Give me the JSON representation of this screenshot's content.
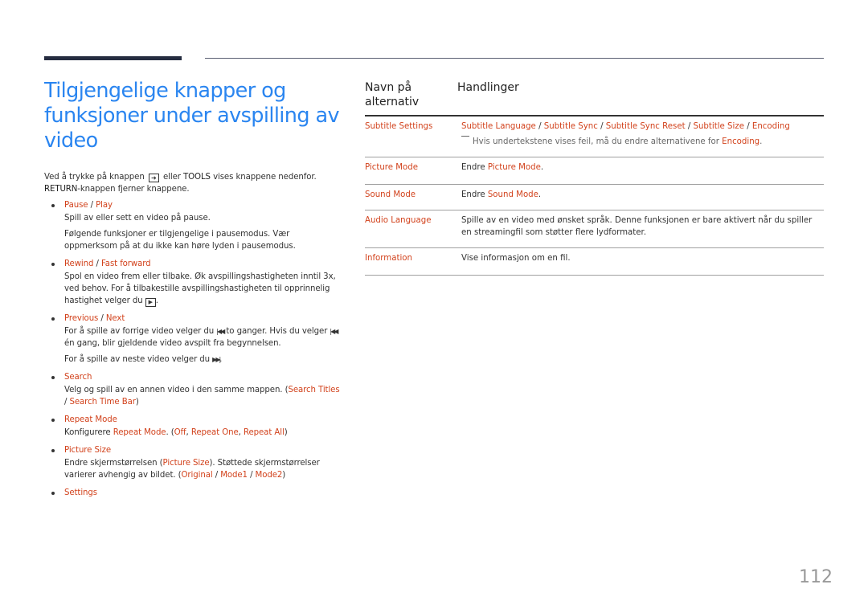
{
  "page": {
    "title": "Tilgjengelige knapper og funksjoner under avspilling av video",
    "page_number": "112"
  },
  "intro": {
    "part1": "Ved å trykke på knappen",
    "icon": "tools-button-icon",
    "part2": "eller",
    "tools": "TOOLS",
    "part3": "vises knappene nedenfor.",
    "return": "RETURN",
    "part4": "-knappen fjerner knappene."
  },
  "items": {
    "pause": {
      "a": "Pause",
      "sep": " / ",
      "b": "Play",
      "desc1": "Spill av eller sett en video på pause.",
      "desc2": "Følgende funksjoner er tilgjengelige i pausemodus. Vær oppmerksom på at du ikke kan høre lyden i pausemodus."
    },
    "rewind": {
      "a": "Rewind",
      "sep": " / ",
      "b": "Fast forward",
      "desc1": "Spol en video frem eller tilbake. Øk avspillingshastigheten inntil 3x, ved behov. For å tilbakestille avspillingshastigheten til opprinnelig hastighet velger du",
      "desc1_end": ".",
      "icon": "play-button-icon"
    },
    "previous": {
      "a": "Previous",
      "sep": " / ",
      "b": "Next",
      "desc1_a": "For å spille av forrige video velger du",
      "desc1_b": "to ganger. Hvis du velger",
      "desc1_c": "én gang, blir gjeldende video avspilt fra begynnelsen.",
      "desc2_a": "For å spille av neste video velger du",
      "desc2_b": ".",
      "prev_icon": "previous-track-icon",
      "next_icon": "next-track-icon"
    },
    "search": {
      "title": "Search",
      "desc_a": "Velg og spill av en annen video i den samme mappen. (",
      "opt1": "Search Titles",
      "sep": " / ",
      "opt2": "Search Time Bar",
      "desc_b": ")"
    },
    "repeat": {
      "title": "Repeat Mode",
      "desc_a": "Konfigurere ",
      "mode": "Repeat Mode",
      "desc_b": ". (",
      "opt1": "Off",
      "comma1": ", ",
      "opt2": "Repeat One",
      "comma2": ", ",
      "opt3": "Repeat All",
      "desc_c": ")"
    },
    "picture_size": {
      "title": "Picture Size",
      "desc_a": "Endre skjermstørrelsen (",
      "name": "Picture Size",
      "desc_b": "). Støttede skjermstørrelser varierer avhengig av bildet. (",
      "opt1": "Original",
      "sep1": " / ",
      "opt2": "Mode1",
      "sep2": " / ",
      "opt3": "Mode2",
      "desc_c": ")"
    },
    "settings": {
      "title": "Settings"
    }
  },
  "table": {
    "headers": [
      "Navn på alternativ",
      "Handlinger"
    ],
    "rows": [
      {
        "name": "Subtitle Settings",
        "actions": [
          "Subtitle Language",
          "Subtitle Sync",
          "Subtitle Sync Reset",
          "Subtitle Size",
          "Encoding"
        ],
        "sep": " / ",
        "note_a": "Hvis undertekstene vises feil, må du endre alternativene for ",
        "note_link": "Encoding",
        "note_b": "."
      },
      {
        "name": "Picture Mode",
        "desc_a": "Endre ",
        "link": "Picture Mode",
        "desc_b": "."
      },
      {
        "name": "Sound Mode",
        "desc_a": "Endre ",
        "link": "Sound Mode",
        "desc_b": "."
      },
      {
        "name": "Audio Language",
        "desc": "Spille av en video med ønsket språk. Denne funksjonen er bare aktivert når du spiller en streamingfil som støtter flere lydformater."
      },
      {
        "name": "Information",
        "desc": "Vise informasjon om en fil."
      }
    ]
  },
  "colors": {
    "title_blue": "#2a85f0",
    "link_red": "#d2421c",
    "header_bar": "#252c40"
  }
}
